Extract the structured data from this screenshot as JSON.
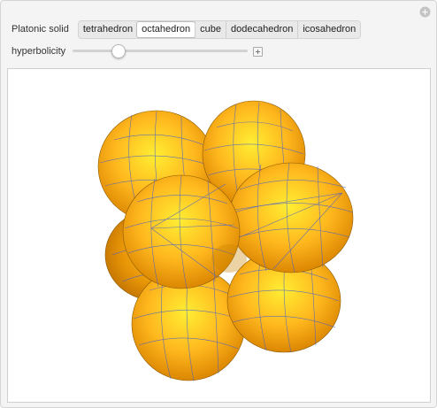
{
  "controls": {
    "solid_label": "Platonic solid",
    "solids": [
      {
        "label": "tetrahedron",
        "active": false
      },
      {
        "label": "octahedron",
        "active": true
      },
      {
        "label": "cube",
        "active": false
      },
      {
        "label": "dodecahedron",
        "active": false
      },
      {
        "label": "icosahedron",
        "active": false
      }
    ],
    "hyperbolicity_label": "hyperbolicity",
    "hyperbolicity_value_fraction": 0.24
  },
  "icons": {
    "corner": "add-circle-icon",
    "slider_expand": "plus-icon"
  },
  "colors": {
    "lobe_light": "#ffee33",
    "lobe_mid": "#ffb81e",
    "lobe_dark": "#d98300",
    "mesh": "#4a5fc8"
  }
}
